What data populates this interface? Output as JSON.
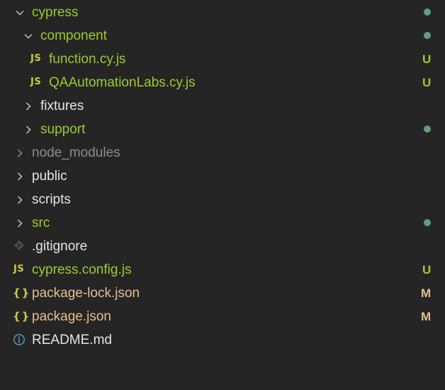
{
  "explorer": {
    "items": [
      {
        "label": "cypress",
        "badge": ""
      },
      {
        "label": "component",
        "badge": ""
      },
      {
        "label": "function.cy.js",
        "badge": "U",
        "icon": "JS"
      },
      {
        "label": "QAAutomationLabs.cy.js",
        "badge": "U",
        "icon": "JS"
      },
      {
        "label": "fixtures",
        "badge": ""
      },
      {
        "label": "support",
        "badge": ""
      },
      {
        "label": "node_modules",
        "badge": ""
      },
      {
        "label": "public",
        "badge": ""
      },
      {
        "label": "scripts",
        "badge": ""
      },
      {
        "label": "src",
        "badge": ""
      },
      {
        "label": ".gitignore",
        "badge": ""
      },
      {
        "label": "cypress.config.js",
        "badge": "U",
        "icon": "JS"
      },
      {
        "label": "package-lock.json",
        "badge": "M",
        "icon": "{}"
      },
      {
        "label": "package.json",
        "badge": "M",
        "icon": "{}"
      },
      {
        "label": "README.md",
        "badge": ""
      }
    ]
  },
  "colors": {
    "background": "#252526",
    "untracked": "#9ccc2c",
    "modified": "#e2c08d",
    "normal": "#e6e6e6",
    "ignored": "#8c8c8c",
    "dot": "#73c991",
    "js_icon": "#cbcb41",
    "info_icon": "#519aba"
  }
}
